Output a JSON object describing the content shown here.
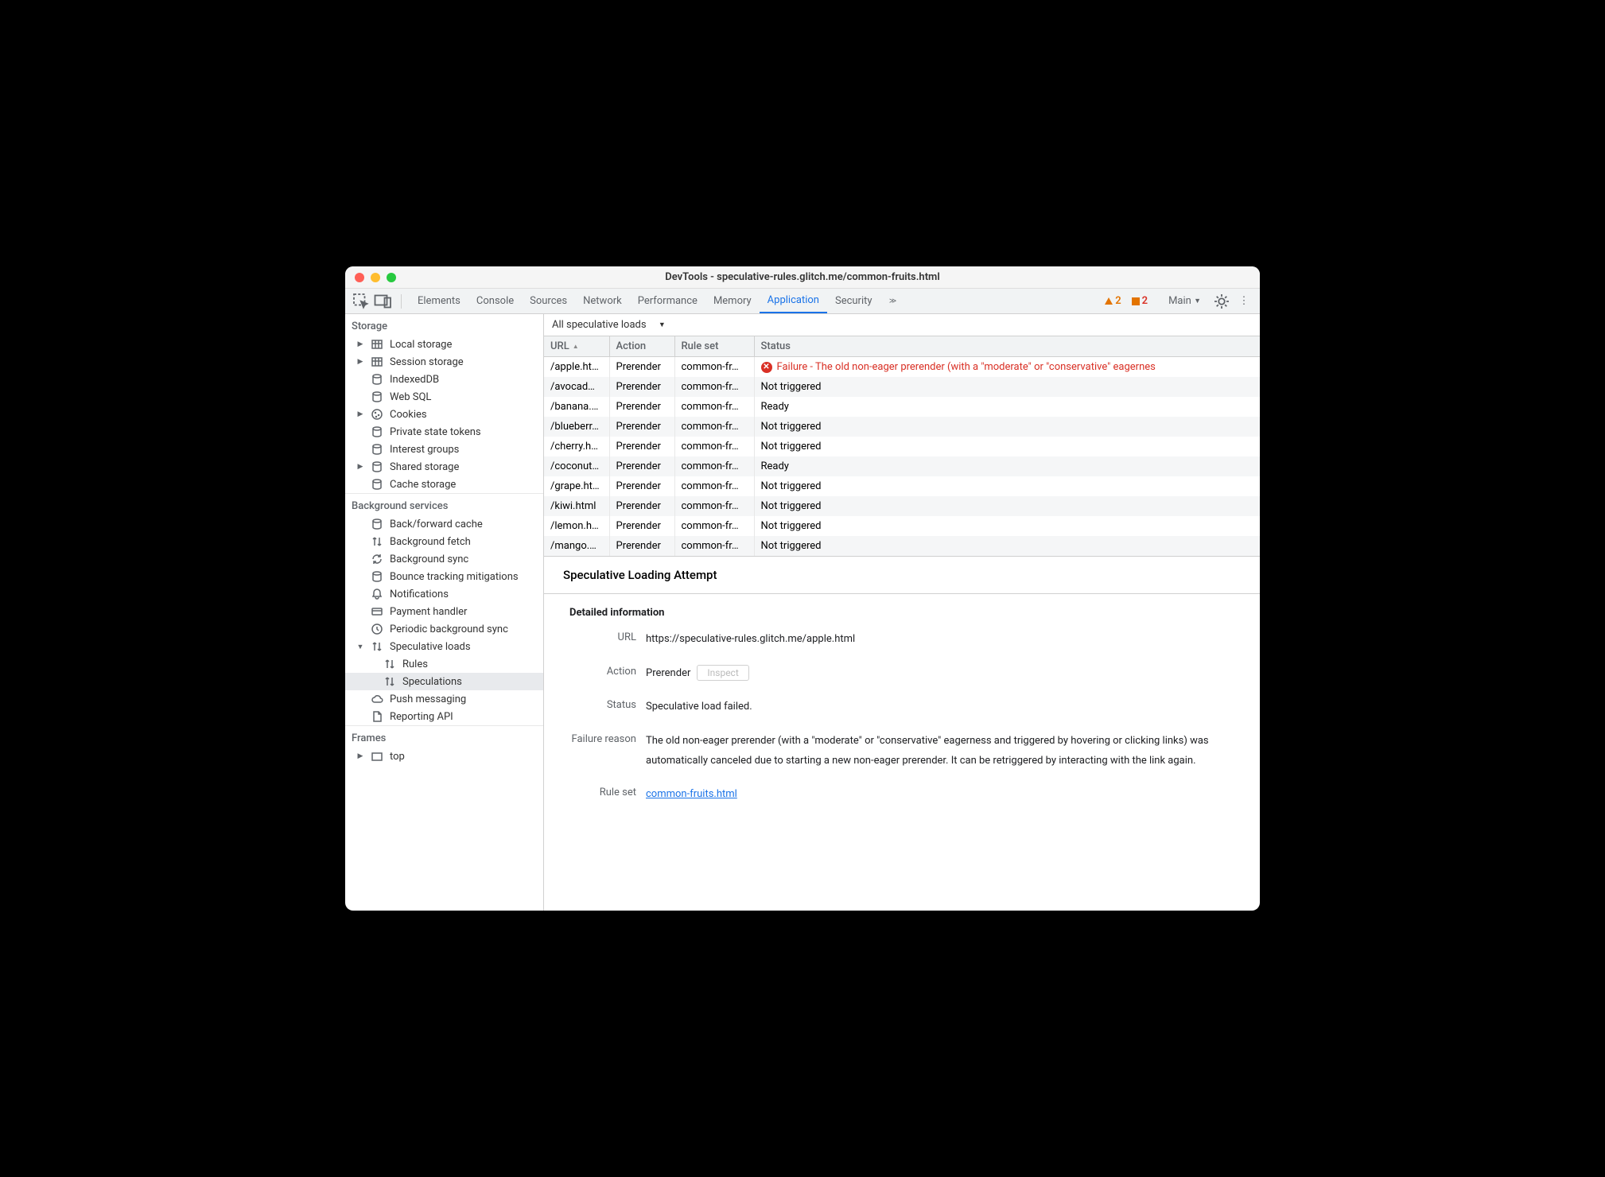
{
  "window": {
    "title": "DevTools - speculative-rules.glitch.me/common-fruits.html"
  },
  "toolbar": {
    "tabs": [
      "Elements",
      "Console",
      "Sources",
      "Network",
      "Performance",
      "Memory",
      "Application",
      "Security"
    ],
    "active_tab": "Application",
    "warnings": "2",
    "errors": "2",
    "target": "Main"
  },
  "sidebar": {
    "sections": [
      {
        "title": "Storage",
        "items": [
          {
            "label": "Local storage",
            "icon": "grid",
            "expand": true
          },
          {
            "label": "Session storage",
            "icon": "grid",
            "expand": true
          },
          {
            "label": "IndexedDB",
            "icon": "db"
          },
          {
            "label": "Web SQL",
            "icon": "db"
          },
          {
            "label": "Cookies",
            "icon": "cookie",
            "expand": true
          },
          {
            "label": "Private state tokens",
            "icon": "db"
          },
          {
            "label": "Interest groups",
            "icon": "db"
          },
          {
            "label": "Shared storage",
            "icon": "db",
            "expand": true
          },
          {
            "label": "Cache storage",
            "icon": "db"
          }
        ]
      },
      {
        "title": "Background services",
        "items": [
          {
            "label": "Back/forward cache",
            "icon": "db"
          },
          {
            "label": "Background fetch",
            "icon": "updown"
          },
          {
            "label": "Background sync",
            "icon": "sync"
          },
          {
            "label": "Bounce tracking mitigations",
            "icon": "db"
          },
          {
            "label": "Notifications",
            "icon": "bell"
          },
          {
            "label": "Payment handler",
            "icon": "card"
          },
          {
            "label": "Periodic background sync",
            "icon": "clock"
          },
          {
            "label": "Speculative loads",
            "icon": "updown",
            "expand": true,
            "open": true,
            "children": [
              {
                "label": "Rules",
                "icon": "updown"
              },
              {
                "label": "Speculations",
                "icon": "updown",
                "selected": true
              }
            ]
          },
          {
            "label": "Push messaging",
            "icon": "cloud"
          },
          {
            "label": "Reporting API",
            "icon": "doc"
          }
        ]
      },
      {
        "title": "Frames",
        "items": [
          {
            "label": "top",
            "icon": "frame",
            "expand": true
          }
        ]
      }
    ]
  },
  "filter": {
    "label": "All speculative loads"
  },
  "table": {
    "headers": [
      "URL",
      "Action",
      "Rule set",
      "Status"
    ],
    "rows": [
      {
        "url": "/apple.html",
        "action": "Prerender",
        "ruleset": "common-fr…",
        "status": "Failure - The old non-eager prerender (with a \"moderate\" or \"conservative\" eagernes",
        "error": true
      },
      {
        "url": "/avocad…",
        "action": "Prerender",
        "ruleset": "common-fr…",
        "status": "Not triggered"
      },
      {
        "url": "/banana.…",
        "action": "Prerender",
        "ruleset": "common-fr…",
        "status": "Ready"
      },
      {
        "url": "/blueberr…",
        "action": "Prerender",
        "ruleset": "common-fr…",
        "status": "Not triggered"
      },
      {
        "url": "/cherry.h…",
        "action": "Prerender",
        "ruleset": "common-fr…",
        "status": "Not triggered"
      },
      {
        "url": "/coconut…",
        "action": "Prerender",
        "ruleset": "common-fr…",
        "status": "Ready"
      },
      {
        "url": "/grape.html",
        "action": "Prerender",
        "ruleset": "common-fr…",
        "status": "Not triggered"
      },
      {
        "url": "/kiwi.html",
        "action": "Prerender",
        "ruleset": "common-fr…",
        "status": "Not triggered"
      },
      {
        "url": "/lemon.h…",
        "action": "Prerender",
        "ruleset": "common-fr…",
        "status": "Not triggered"
      },
      {
        "url": "/mango.…",
        "action": "Prerender",
        "ruleset": "common-fr…",
        "status": "Not triggered"
      }
    ]
  },
  "detail": {
    "title": "Speculative Loading Attempt",
    "section_title": "Detailed information",
    "url_label": "URL",
    "url_value": "https://speculative-rules.glitch.me/apple.html",
    "action_label": "Action",
    "action_value": "Prerender",
    "inspect_label": "Inspect",
    "status_label": "Status",
    "status_value": "Speculative load failed.",
    "failure_label": "Failure reason",
    "failure_value": "The old non-eager prerender (with a \"moderate\" or \"conservative\" eagerness and triggered by hovering or clicking links) was automatically canceled due to starting a new non-eager prerender. It can be retriggered by interacting with the link again.",
    "ruleset_label": "Rule set",
    "ruleset_value": "common-fruits.html"
  }
}
